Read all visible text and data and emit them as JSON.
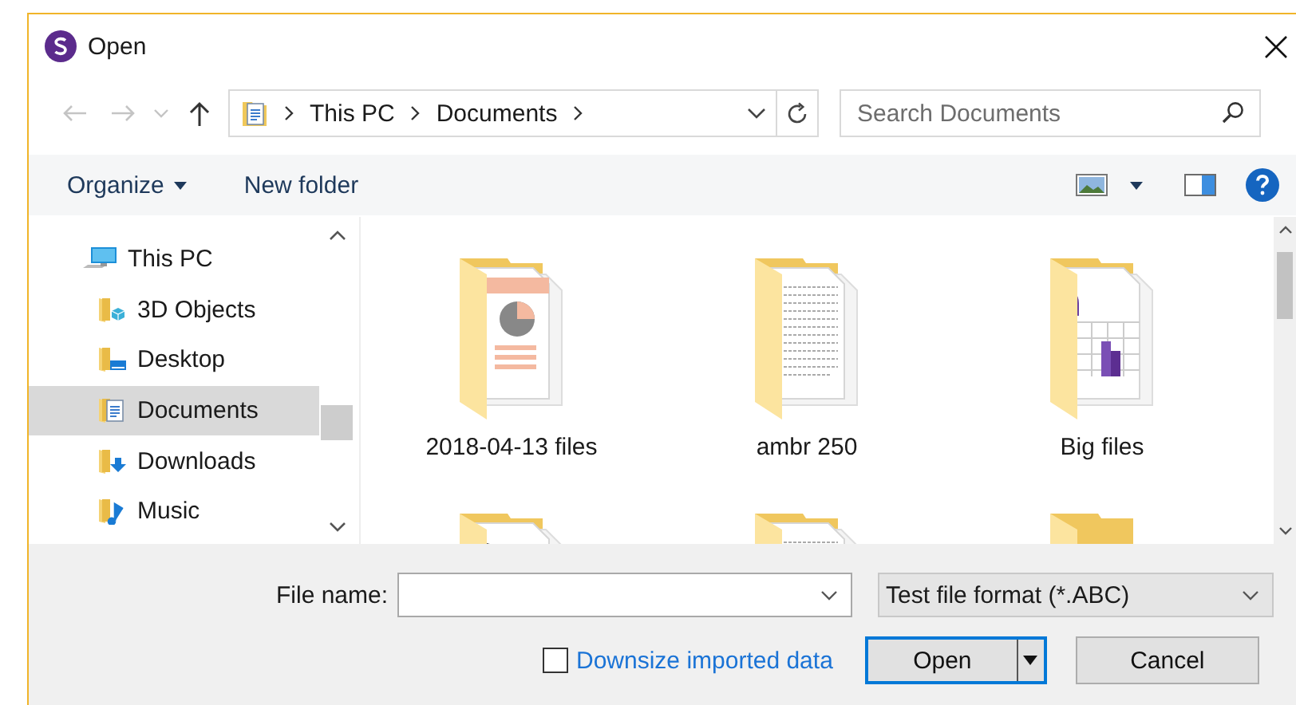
{
  "window": {
    "title": "Open"
  },
  "address": {
    "breadcrumbs": [
      "This PC",
      "Documents"
    ]
  },
  "search": {
    "placeholder": "Search Documents"
  },
  "toolbar": {
    "organize": "Organize",
    "new_folder": "New folder"
  },
  "nav": {
    "items": [
      {
        "label": "This PC",
        "kind": "pc",
        "selected": false,
        "children": [
          {
            "label": "3D Objects",
            "kind": "objects",
            "selected": false
          },
          {
            "label": "Desktop",
            "kind": "desktop",
            "selected": false
          },
          {
            "label": "Documents",
            "kind": "documents",
            "selected": true
          },
          {
            "label": "Downloads",
            "kind": "downloads",
            "selected": false
          },
          {
            "label": "Music",
            "kind": "music",
            "selected": false
          }
        ]
      }
    ]
  },
  "folders": [
    {
      "name": "2018-04-13 files",
      "kind": "slides"
    },
    {
      "name": "ambr 250",
      "kind": "document"
    },
    {
      "name": "Big files",
      "kind": "chart"
    },
    {
      "kind": "dark"
    },
    {
      "kind": "document"
    },
    {
      "kind": "empty"
    }
  ],
  "file_name": {
    "label": "File name:"
  },
  "file_type": {
    "value": "Test file format (*.ABC)"
  },
  "option": {
    "label": "Downsize imported data",
    "checked": false
  },
  "buttons": [
    {
      "label": "Open",
      "kind": "split",
      "default": true
    },
    {
      "label": "Cancel",
      "kind": "plain",
      "default": false
    }
  ]
}
